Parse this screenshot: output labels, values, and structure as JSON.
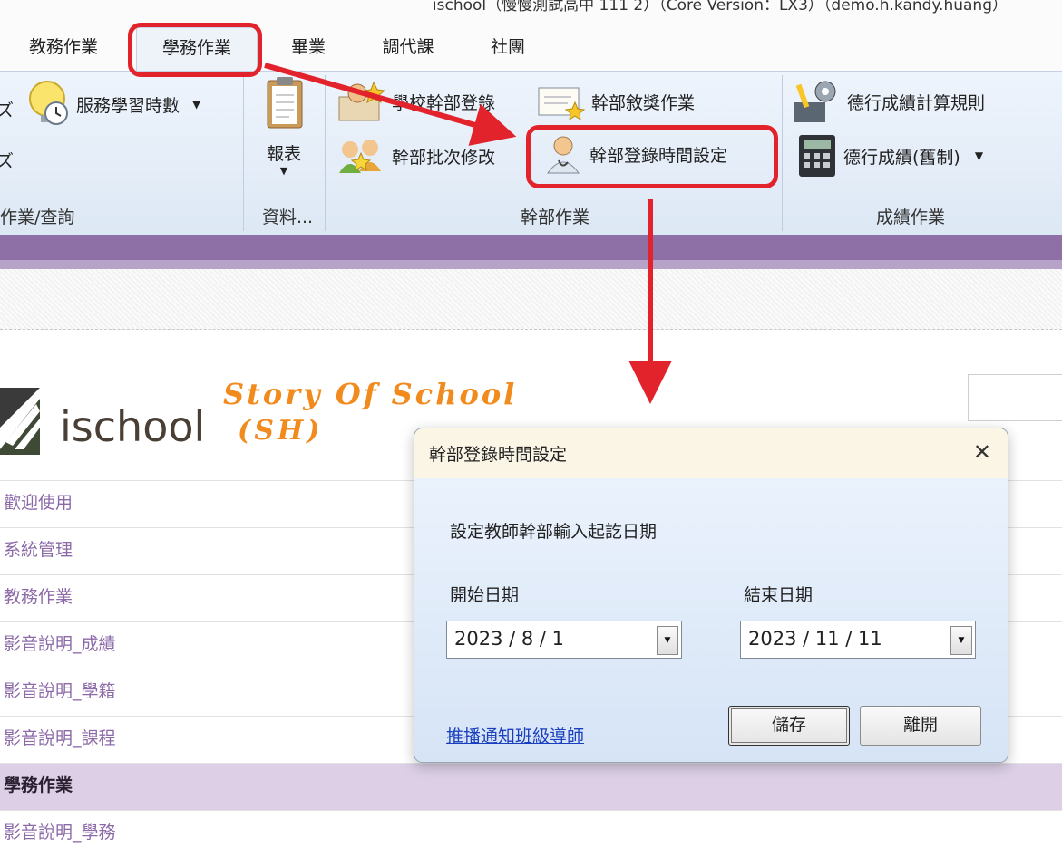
{
  "window": {
    "title": "ischool（慢慢測試高中 111 2）（Core Version：LX3）（demo.h.kandy.huang）"
  },
  "menu_tabs": [
    "教務作業",
    "學務作業",
    "畢業",
    "調代課",
    "社團"
  ],
  "ribbon": {
    "service_learning": "服務學習時數",
    "left_group_label": "作業/查詢",
    "report_label": "報表",
    "data_group_label": "資料...",
    "cadre": {
      "register": "學校幹部登錄",
      "award": "幹部敘獎作業",
      "batch_edit": "幹部批次修改",
      "time_setting": "幹部登錄時間設定",
      "group_label": "幹部作業"
    },
    "grade": {
      "calc_rule": "德行成績計算規則",
      "legacy": "德行成績(舊制)",
      "group_label": "成績作業"
    }
  },
  "banner": {
    "logo": "ischool",
    "story": "Story Of School",
    "story_sub": "(SH)"
  },
  "nav": [
    "歡迎使用",
    "系統管理",
    "教務作業",
    "影音說明_成績",
    "影音說明_學籍",
    "影音說明_課程",
    "學務作業",
    "影音說明_學務"
  ],
  "dialog": {
    "title": "幹部登錄時間設定",
    "close": "✕",
    "description": "設定教師幹部輸入起訖日期",
    "start_label": "開始日期",
    "end_label": "結束日期",
    "start_value": "2023 / 8 / 1",
    "end_value": "2023 / 11 / 11",
    "notify_link": "推播通知班級導師",
    "save_button": "儲存",
    "leave_button": "離開"
  },
  "colors": {
    "highlight": "#e3232b",
    "purple_bar": "#8e6fa6",
    "nav_text": "#8c6aa8",
    "link": "#1a3fbf"
  }
}
